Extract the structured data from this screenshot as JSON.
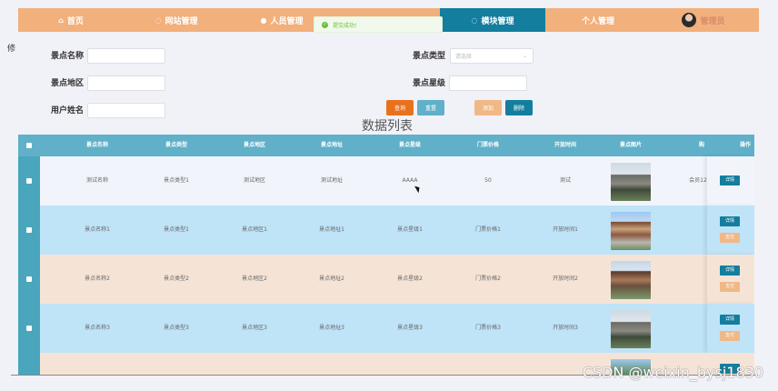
{
  "nav": {
    "items": [
      {
        "label": "首页",
        "icon": "home-icon",
        "glyph": "⌂",
        "active": false
      },
      {
        "label": "网站管理",
        "icon": "globe-icon",
        "glyph": "◌",
        "active": false
      },
      {
        "label": "人员管理",
        "icon": "user-icon",
        "glyph": "●",
        "active": false
      },
      {
        "label": "",
        "icon": "",
        "glyph": "",
        "active": false
      },
      {
        "label": "模块管理",
        "icon": "module-icon",
        "glyph": "◌",
        "active": true
      },
      {
        "label": "个人管理",
        "icon": "",
        "glyph": "",
        "active": false
      }
    ],
    "user_name": "管理员"
  },
  "toast": {
    "message": "提交成功!"
  },
  "side_label": "修",
  "search": {
    "name_label": "景点名称",
    "type_label": "景点类型",
    "type_placeholder": "请选择",
    "area_label": "景点地区",
    "star_label": "景点星级",
    "user_label": "用户姓名"
  },
  "buttons": {
    "query": "查询",
    "reset": "重置",
    "add": "添加",
    "delete": "删除"
  },
  "list_title": "数据列表",
  "table": {
    "headers": [
      "景点名称",
      "景点类型",
      "景点地区",
      "景点地址",
      "景点星级",
      "门票价格",
      "开放时间",
      "景点图片",
      "购",
      "操作"
    ],
    "rows": [
      {
        "cells": [
          "测试名称",
          "景点类型1",
          "测试地区",
          "测试地址",
          "AAAA",
          "50",
          "测试"
        ],
        "extra": "会员12",
        "ops": [
          "详情"
        ],
        "bg": "#f1f5fb"
      },
      {
        "cells": [
          "景点名称1",
          "景点类型1",
          "景点地区1",
          "景点地址1",
          "景点星级1",
          "门票价格1",
          "开放时间1"
        ],
        "extra": "",
        "ops": [
          "详情",
          "支付"
        ],
        "bg": "#bfe3f7"
      },
      {
        "cells": [
          "景点名称2",
          "景点类型2",
          "景点地区2",
          "景点地址2",
          "景点星级2",
          "门票价格2",
          "开放时间2"
        ],
        "extra": "",
        "ops": [
          "详情",
          "支付"
        ],
        "bg": "#f5e4d6"
      },
      {
        "cells": [
          "景点名称3",
          "景点类型3",
          "景点地区3",
          "景点地址3",
          "景点星级3",
          "门票价格3",
          "开放时间3"
        ],
        "extra": "",
        "ops": [
          "详情",
          "支付"
        ],
        "bg": "#bfe3f7"
      }
    ]
  },
  "watermark": "CSDN @weixin_bysj1830",
  "colors": {
    "nav_bg": "#f2b07c",
    "nav_active": "#137e9e",
    "header_bg": "#5fb0c8",
    "query_btn": "#e8721c",
    "reset_btn": "#5fb0c8",
    "add_btn": "#f0b887",
    "delete_btn": "#137e9e"
  }
}
